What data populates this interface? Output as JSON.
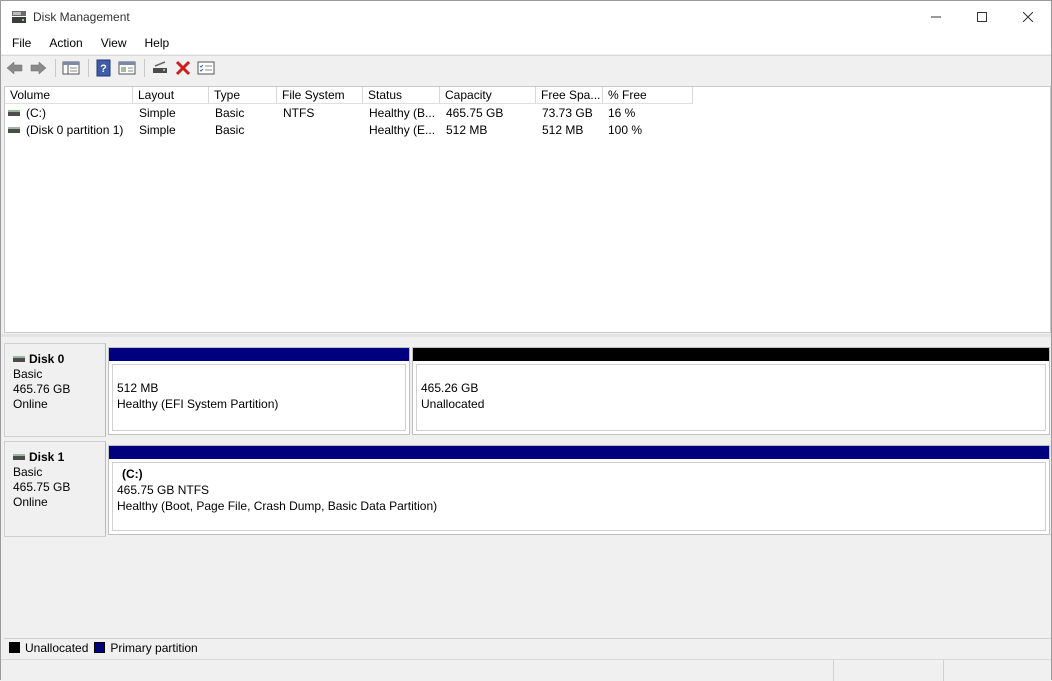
{
  "window": {
    "title": "Disk Management"
  },
  "menu": [
    "File",
    "Action",
    "View",
    "Help"
  ],
  "toolbar": {
    "icons": [
      "back-arrow-icon",
      "forward-arrow-icon",
      "console-tree-icon",
      "help-icon",
      "properties-icon",
      "connect-drive-icon",
      "delete-icon",
      "checklist-icon"
    ]
  },
  "volume_table": {
    "columns": [
      "Volume",
      "Layout",
      "Type",
      "File System",
      "Status",
      "Capacity",
      "Free Spa...",
      "% Free"
    ],
    "rows": [
      {
        "volume": "(C:)",
        "layout": "Simple",
        "type": "Basic",
        "filesystem": "NTFS",
        "status": "Healthy (B...",
        "capacity": "465.75 GB",
        "free": "73.73 GB",
        "pct_free": "16 %"
      },
      {
        "volume": "(Disk 0 partition 1)",
        "layout": "Simple",
        "type": "Basic",
        "filesystem": "",
        "status": "Healthy (E...",
        "capacity": "512 MB",
        "free": "512 MB",
        "pct_free": "100 %"
      }
    ]
  },
  "disks": [
    {
      "name": "Disk 0",
      "type": "Basic",
      "size": "465.76 GB",
      "state": "Online",
      "partitions": [
        {
          "volume": "",
          "size": "512 MB",
          "status": "Healthy (EFI System Partition)",
          "kind": "primary"
        },
        {
          "volume": "",
          "size": "465.26 GB",
          "status": "Unallocated",
          "kind": "unallocated"
        }
      ]
    },
    {
      "name": "Disk 1",
      "type": "Basic",
      "size": "465.75 GB",
      "state": "Online",
      "partitions": [
        {
          "volume": "(C:)",
          "size": "465.75 GB NTFS",
          "status": "Healthy (Boot, Page File, Crash Dump, Basic Data Partition)",
          "kind": "primary"
        }
      ]
    }
  ],
  "legend": [
    {
      "label": "Unallocated",
      "color": "#000000"
    },
    {
      "label": "Primary partition",
      "color": "#00007f"
    }
  ],
  "colors": {
    "primary": "#00007f",
    "unallocated": "#000000"
  }
}
